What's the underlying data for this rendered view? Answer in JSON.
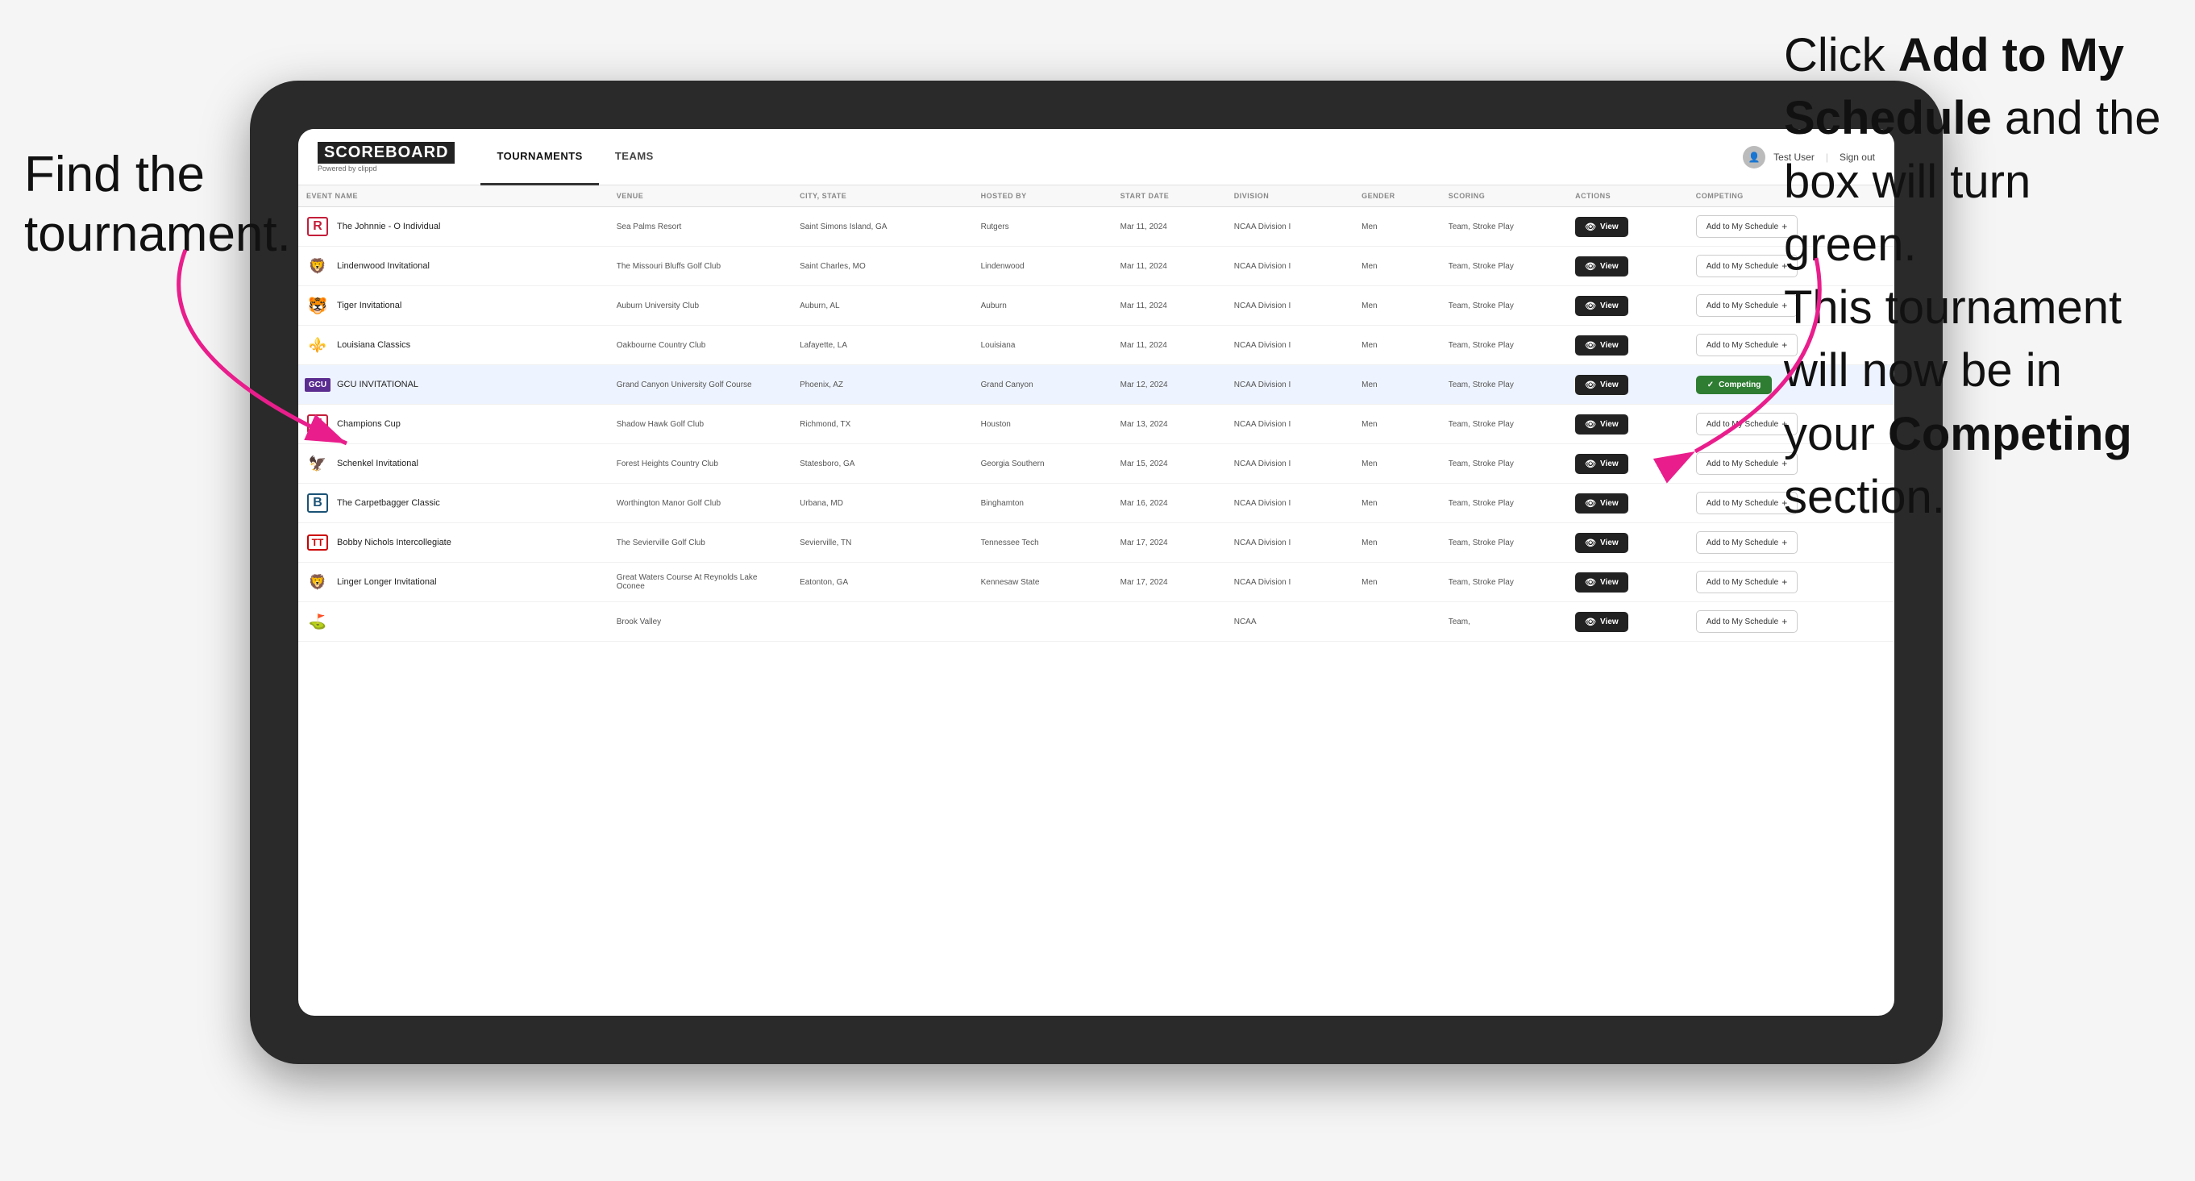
{
  "annotations": {
    "left": "Find the\ntournament.",
    "right_line1": "Click ",
    "right_bold1": "Add to My\nSchedule",
    "right_line2": " and the\nbox will turn green.\nThis tournament\nwill now be in\nyour ",
    "right_bold2": "Competing",
    "right_line3": "\nsection."
  },
  "header": {
    "logo": "SCOREBOARD",
    "logo_sub": "Powered by clippd",
    "nav": [
      "TOURNAMENTS",
      "TEAMS"
    ],
    "active_nav": "TOURNAMENTS",
    "user": "Test User",
    "sign_out": "Sign out"
  },
  "table": {
    "columns": [
      "EVENT NAME",
      "VENUE",
      "CITY, STATE",
      "HOSTED BY",
      "START DATE",
      "DIVISION",
      "GENDER",
      "SCORING",
      "ACTIONS",
      "COMPETING"
    ],
    "rows": [
      {
        "logo": "R",
        "logo_type": "r",
        "name": "The Johnnie - O Individual",
        "venue": "Sea Palms Resort",
        "city": "Saint Simons Island, GA",
        "hosted": "Rutgers",
        "date": "Mar 11, 2024",
        "division": "NCAA Division I",
        "gender": "Men",
        "scoring": "Team, Stroke Play",
        "status": "add",
        "highlighted": false
      },
      {
        "logo": "L",
        "logo_type": "l",
        "name": "Lindenwood Invitational",
        "venue": "The Missouri Bluffs Golf Club",
        "city": "Saint Charles, MO",
        "hosted": "Lindenwood",
        "date": "Mar 11, 2024",
        "division": "NCAA Division I",
        "gender": "Men",
        "scoring": "Team, Stroke Play",
        "status": "add",
        "highlighted": false
      },
      {
        "logo": "🐯",
        "logo_type": "tiger",
        "name": "Tiger Invitational",
        "venue": "Auburn University Club",
        "city": "Auburn, AL",
        "hosted": "Auburn",
        "date": "Mar 11, 2024",
        "division": "NCAA Division I",
        "gender": "Men",
        "scoring": "Team, Stroke Play",
        "status": "add",
        "highlighted": false
      },
      {
        "logo": "🏴",
        "logo_type": "la",
        "name": "Louisiana Classics",
        "venue": "Oakbourne Country Club",
        "city": "Lafayette, LA",
        "hosted": "Louisiana",
        "date": "Mar 11, 2024",
        "division": "NCAA Division I",
        "gender": "Men",
        "scoring": "Team, Stroke Play",
        "status": "add",
        "highlighted": false
      },
      {
        "logo": "GCU",
        "logo_type": "gcu",
        "name": "GCU INVITATIONAL",
        "venue": "Grand Canyon University Golf Course",
        "city": "Phoenix, AZ",
        "hosted": "Grand Canyon",
        "date": "Mar 12, 2024",
        "division": "NCAA Division I",
        "gender": "Men",
        "scoring": "Team, Stroke Play",
        "status": "competing",
        "highlighted": true
      },
      {
        "logo": "H",
        "logo_type": "h",
        "name": "Champions Cup",
        "venue": "Shadow Hawk Golf Club",
        "city": "Richmond, TX",
        "hosted": "Houston",
        "date": "Mar 13, 2024",
        "division": "NCAA Division I",
        "gender": "Men",
        "scoring": "Team, Stroke Play",
        "status": "add",
        "highlighted": false
      },
      {
        "logo": "🦅",
        "logo_type": "gs",
        "name": "Schenkel Invitational",
        "venue": "Forest Heights Country Club",
        "city": "Statesboro, GA",
        "hosted": "Georgia Southern",
        "date": "Mar 15, 2024",
        "division": "NCAA Division I",
        "gender": "Men",
        "scoring": "Team, Stroke Play",
        "status": "add",
        "highlighted": false
      },
      {
        "logo": "B",
        "logo_type": "b",
        "name": "The Carpetbagger Classic",
        "venue": "Worthington Manor Golf Club",
        "city": "Urbana, MD",
        "hosted": "Binghamton",
        "date": "Mar 16, 2024",
        "division": "NCAA Division I",
        "gender": "Men",
        "scoring": "Team, Stroke Play",
        "status": "add",
        "highlighted": false
      },
      {
        "logo": "TT",
        "logo_type": "tt",
        "name": "Bobby Nichols Intercollegiate",
        "venue": "The Sevierville Golf Club",
        "city": "Sevierville, TN",
        "hosted": "Tennessee Tech",
        "date": "Mar 17, 2024",
        "division": "NCAA Division I",
        "gender": "Men",
        "scoring": "Team, Stroke Play",
        "status": "add",
        "highlighted": false
      },
      {
        "logo": "🦁",
        "logo_type": "ksu",
        "name": "Linger Longer Invitational",
        "venue": "Great Waters Course At Reynolds Lake Oconee",
        "city": "Eatonton, GA",
        "hosted": "Kennesaw State",
        "date": "Mar 17, 2024",
        "division": "NCAA Division I",
        "gender": "Men",
        "scoring": "Team, Stroke Play",
        "status": "add",
        "highlighted": false
      },
      {
        "logo": "🏌️",
        "logo_type": "other",
        "name": "",
        "venue": "Brook Valley",
        "city": "",
        "hosted": "",
        "date": "",
        "division": "NCAA",
        "gender": "",
        "scoring": "Team,",
        "status": "add",
        "highlighted": false,
        "partial": true
      }
    ],
    "view_label": "View",
    "add_label": "Add to My Schedule",
    "competing_label": "Competing"
  }
}
